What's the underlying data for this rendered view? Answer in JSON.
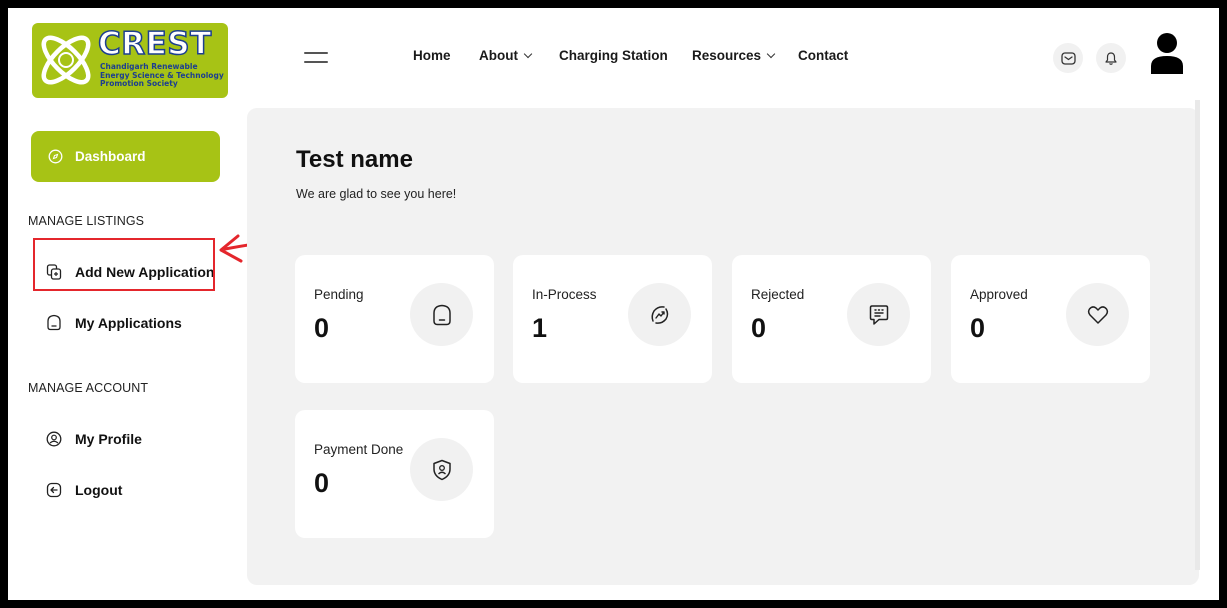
{
  "logo": {
    "brand": "CREST",
    "tagline_lines": [
      "Chandigarh Renewable",
      "Energy Science & Technology",
      "Promotion Society"
    ]
  },
  "nav": {
    "items": [
      {
        "label": "Home",
        "dropdown": false
      },
      {
        "label": "About",
        "dropdown": true
      },
      {
        "label": "Charging Station",
        "dropdown": false
      },
      {
        "label": "Resources",
        "dropdown": true
      },
      {
        "label": "Contact",
        "dropdown": false
      }
    ]
  },
  "header_icons": [
    "mail-icon",
    "bell-icon",
    "user-avatar-icon"
  ],
  "sidebar": {
    "dashboard_label": "Dashboard",
    "manage_listings_title": "MANAGE LISTINGS",
    "add_new_label": "Add New Application",
    "my_applications_label": "My Applications",
    "manage_account_title": "MANAGE ACCOUNT",
    "my_profile_label": "My Profile",
    "logout_label": "Logout"
  },
  "main": {
    "title": "Test name",
    "subtitle": "We are glad to see you here!",
    "stats": [
      {
        "label": "Pending",
        "value": "0",
        "icon": "home-icon"
      },
      {
        "label": "In-Process",
        "value": "1",
        "icon": "trend-icon"
      },
      {
        "label": "Rejected",
        "value": "0",
        "icon": "message-icon"
      },
      {
        "label": "Approved",
        "value": "0",
        "icon": "heart-icon"
      },
      {
        "label": "Payment Done",
        "value": "0",
        "icon": "shield-user-icon"
      }
    ]
  },
  "colors": {
    "accent": "#a7c315",
    "highlight": "#e4262c",
    "brand_blue": "#1d3f8f",
    "main_bg": "#f2f2f2"
  }
}
